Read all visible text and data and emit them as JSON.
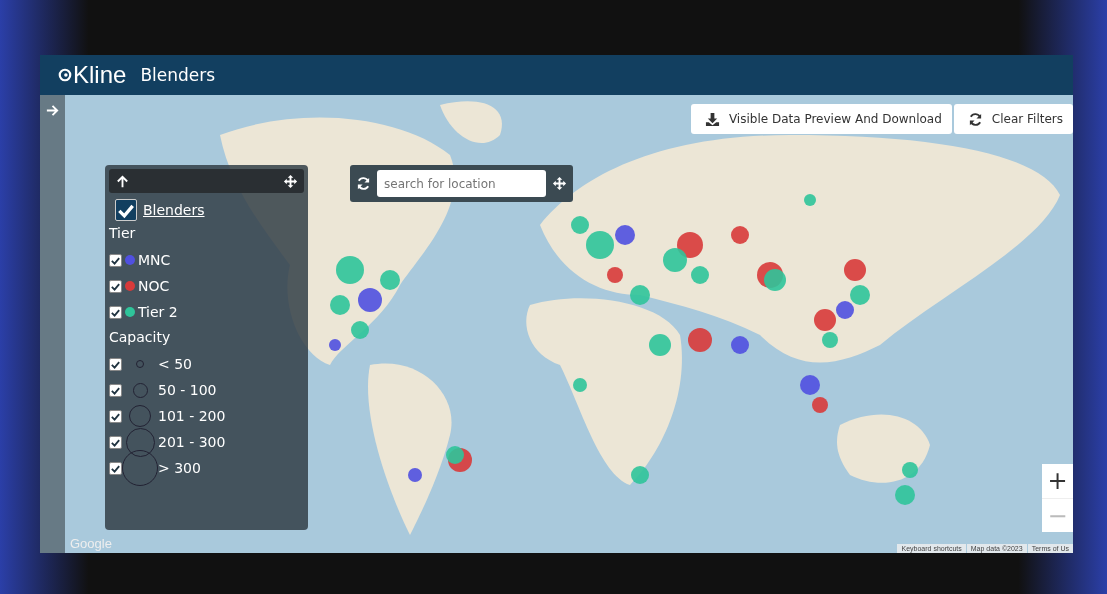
{
  "header": {
    "logo": "Kline",
    "title": "Blenders"
  },
  "legend": {
    "layer": {
      "label": "Blenders",
      "checked": true
    },
    "tier_heading": "Tier",
    "tiers": [
      {
        "label": "MNC",
        "checked": true,
        "color": "#5050e0"
      },
      {
        "label": "NOC",
        "checked": true,
        "color": "#d83a3a"
      },
      {
        "label": "Tier 2",
        "checked": true,
        "color": "#2fc49a"
      }
    ],
    "capacity_heading": "Capacity",
    "capacities": [
      {
        "label": "< 50",
        "checked": true
      },
      {
        "label": "50 - 100",
        "checked": true
      },
      {
        "label": "101 - 200",
        "checked": true
      },
      {
        "label": "201 - 300",
        "checked": true
      },
      {
        "label": "> 300",
        "checked": true
      }
    ]
  },
  "search": {
    "placeholder": "search for location"
  },
  "actions": [
    {
      "label": "Visible Data Preview And Download",
      "kind": "download"
    },
    {
      "label": "Clear Filters",
      "kind": "refresh"
    }
  ],
  "zoom": {
    "in": "+",
    "out": "−"
  },
  "attribution": {
    "logo": "Google",
    "links": [
      "Keyboard shortcuts",
      "Map data ©2023",
      "Terms of Us"
    ]
  }
}
